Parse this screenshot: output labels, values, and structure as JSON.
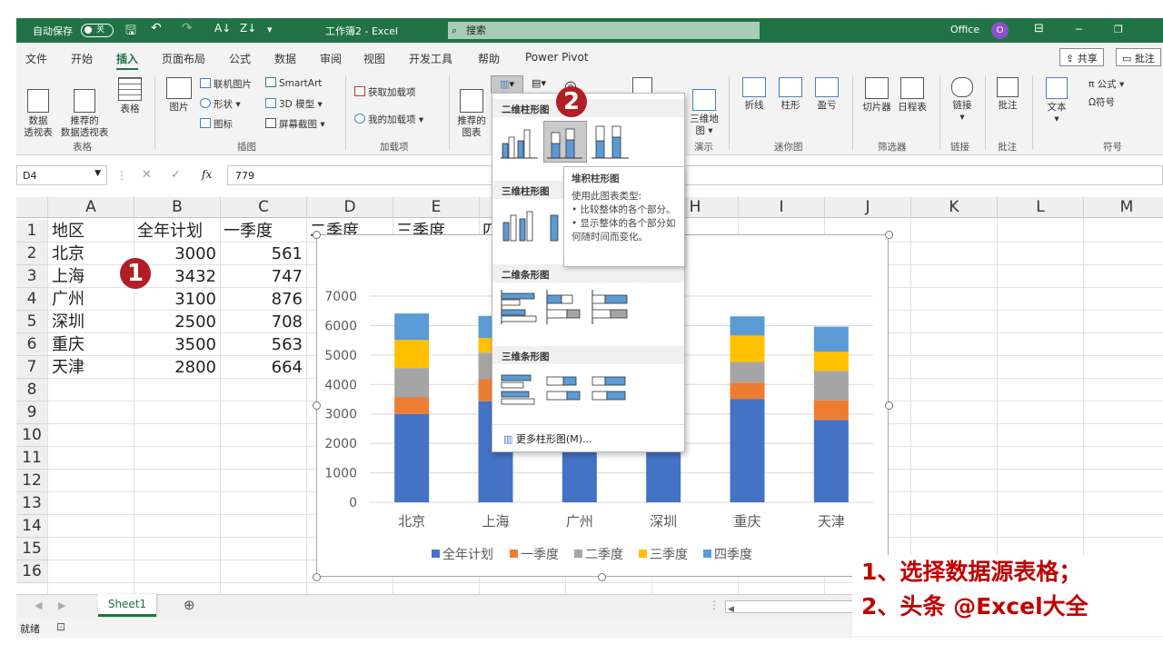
{
  "titlebar": {
    "autosave": "自动保存",
    "autosave_state": "关",
    "doc_title": "工作簿2 - Excel",
    "search": "搜索",
    "account": "Office",
    "avatar": "O",
    "minimize": "─",
    "restore": "❐"
  },
  "tabs": [
    "文件",
    "开始",
    "插入",
    "页面布局",
    "公式",
    "数据",
    "审阅",
    "视图",
    "开发工具",
    "帮助",
    "Power Pivot"
  ],
  "active_tab": "插入",
  "share": "共享",
  "comments": "批注",
  "ribbon": {
    "groups": {
      "tables": "表格",
      "illustrations": "插图",
      "addins": "加载项",
      "tours": "演示",
      "sparklines": "迷你图",
      "filters": "筛选器",
      "links": "链接",
      "comments": "批注",
      "symbols": "符号"
    },
    "pivot": "数据\n透视表",
    "rec_pivot": "推荐的\n数据透视表",
    "table": "表格",
    "picture": "图片",
    "online_pic": "联机图片",
    "shapes": "形状",
    "icons": "图标",
    "smartart": "SmartArt",
    "model3d": "3D 模型",
    "screenshot": "屏幕截图",
    "get_addins": "获取加载项",
    "my_addins": "我的加载项",
    "rec_charts": "推荐的\n图表",
    "map3d": "三维地\n图",
    "line": "折线",
    "column": "柱形",
    "winloss": "盈亏",
    "slicer": "切片器",
    "timeline": "日程表",
    "link": "链接",
    "comment": "批注",
    "text": "文本",
    "equation": "公式",
    "symbol": "符号"
  },
  "namebox": "D4",
  "formula_value": "779",
  "columns": [
    "A",
    "B",
    "C",
    "D",
    "E",
    "F",
    "G",
    "H",
    "I",
    "J",
    "K",
    "L",
    "M"
  ],
  "rows": [
    "1",
    "2",
    "3",
    "4",
    "5",
    "6",
    "7",
    "8",
    "9",
    "10",
    "11",
    "12",
    "13",
    "14",
    "15",
    "16"
  ],
  "table": {
    "headers": [
      "地区",
      "全年计划",
      "一季度",
      "二季度",
      "三季度",
      "四"
    ],
    "rows": [
      [
        "北京",
        "3000",
        "561"
      ],
      [
        "上海",
        "3432",
        "747"
      ],
      [
        "广州",
        "3100",
        "876"
      ],
      [
        "深圳",
        "2500",
        "708"
      ],
      [
        "重庆",
        "3500",
        "563"
      ],
      [
        "天津",
        "2800",
        "664"
      ]
    ]
  },
  "badges": {
    "one": "1",
    "two": "2"
  },
  "chart_data": {
    "type": "bar",
    "stacked": true,
    "categories": [
      "北京",
      "上海",
      "广州",
      "深圳",
      "重庆",
      "天津"
    ],
    "series": [
      {
        "name": "全年计划",
        "color": "#4472c4",
        "values": [
          3000,
          3432,
          3100,
          2500,
          3500,
          2800
        ]
      },
      {
        "name": "一季度",
        "color": "#ed7d31",
        "values": [
          561,
          747,
          876,
          708,
          563,
          664
        ]
      },
      {
        "name": "二季度",
        "color": "#a5a5a5",
        "values": [
          1000,
          900,
          0,
          0,
          700,
          1000
        ]
      },
      {
        "name": "三季度",
        "color": "#ffc000",
        "values": [
          950,
          500,
          0,
          0,
          900,
          650
        ]
      },
      {
        "name": "四季度",
        "color": "#5b9bd5",
        "values": [
          900,
          750,
          0,
          0,
          650,
          850
        ]
      }
    ],
    "ylim": [
      0,
      7000
    ],
    "yticks": [
      "0",
      "1000",
      "2000",
      "3000",
      "4000",
      "5000",
      "6000",
      "7000"
    ],
    "legend": "bottom"
  },
  "gallery": {
    "sec1": "二维柱形图",
    "sec2": "三维柱形图",
    "sec3": "二维条形图",
    "sec4": "三维条形图",
    "more": "更多柱形图(M)..."
  },
  "tooltip": {
    "title": "堆积柱形图",
    "line1": "使用此图表类型:",
    "line2": "• 比较整体的各个部分。",
    "line3": "• 显示整体的各个部分如何随时间而变化。"
  },
  "sheet_tab": "Sheet1",
  "status": "就绪",
  "annotation": {
    "line1": "1、选择数据源表格；",
    "line2": "2、头条 @Excel大全"
  }
}
